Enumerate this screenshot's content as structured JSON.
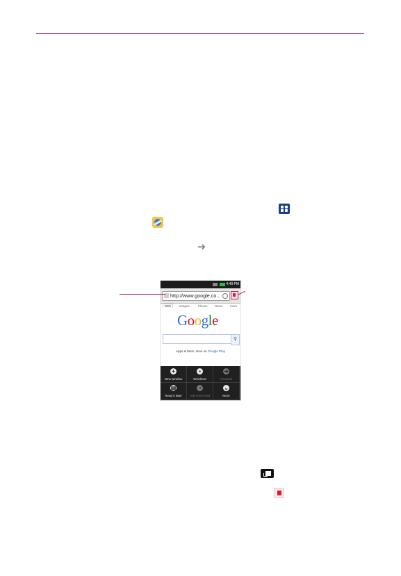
{
  "phone": {
    "url": "http://www.google.co...",
    "status_time": "4:49 PM",
    "tabs": [
      "Web",
      "Images",
      "Places",
      "News",
      "more"
    ],
    "logo_letters": [
      "G",
      "o",
      "o",
      "g",
      "l",
      "e"
    ],
    "logo_colors": [
      "#3369e8",
      "#d50f25",
      "#eeb211",
      "#3369e8",
      "#009925",
      "#d50f25"
    ],
    "promo_text": "Apps & More. Now on",
    "promo_link": "Google Play",
    "menu": [
      {
        "label": "New window",
        "icon": "plus-icon",
        "enabled": true
      },
      {
        "label": "Windows",
        "icon": "windows-icon",
        "enabled": true
      },
      {
        "label": "Forward",
        "icon": "arrow-right-icon",
        "enabled": false
      },
      {
        "label": "Read it later",
        "icon": "page-icon",
        "enabled": true
      },
      {
        "label": "Add RSS feed",
        "icon": "rss-icon",
        "enabled": false
      },
      {
        "label": "More",
        "icon": "chevron-down-icon",
        "enabled": true
      }
    ]
  },
  "colors": {
    "rule": "#9b1f7a",
    "bookmark_red": "#d21d2b",
    "apps_blue": "#1a3f8f"
  }
}
